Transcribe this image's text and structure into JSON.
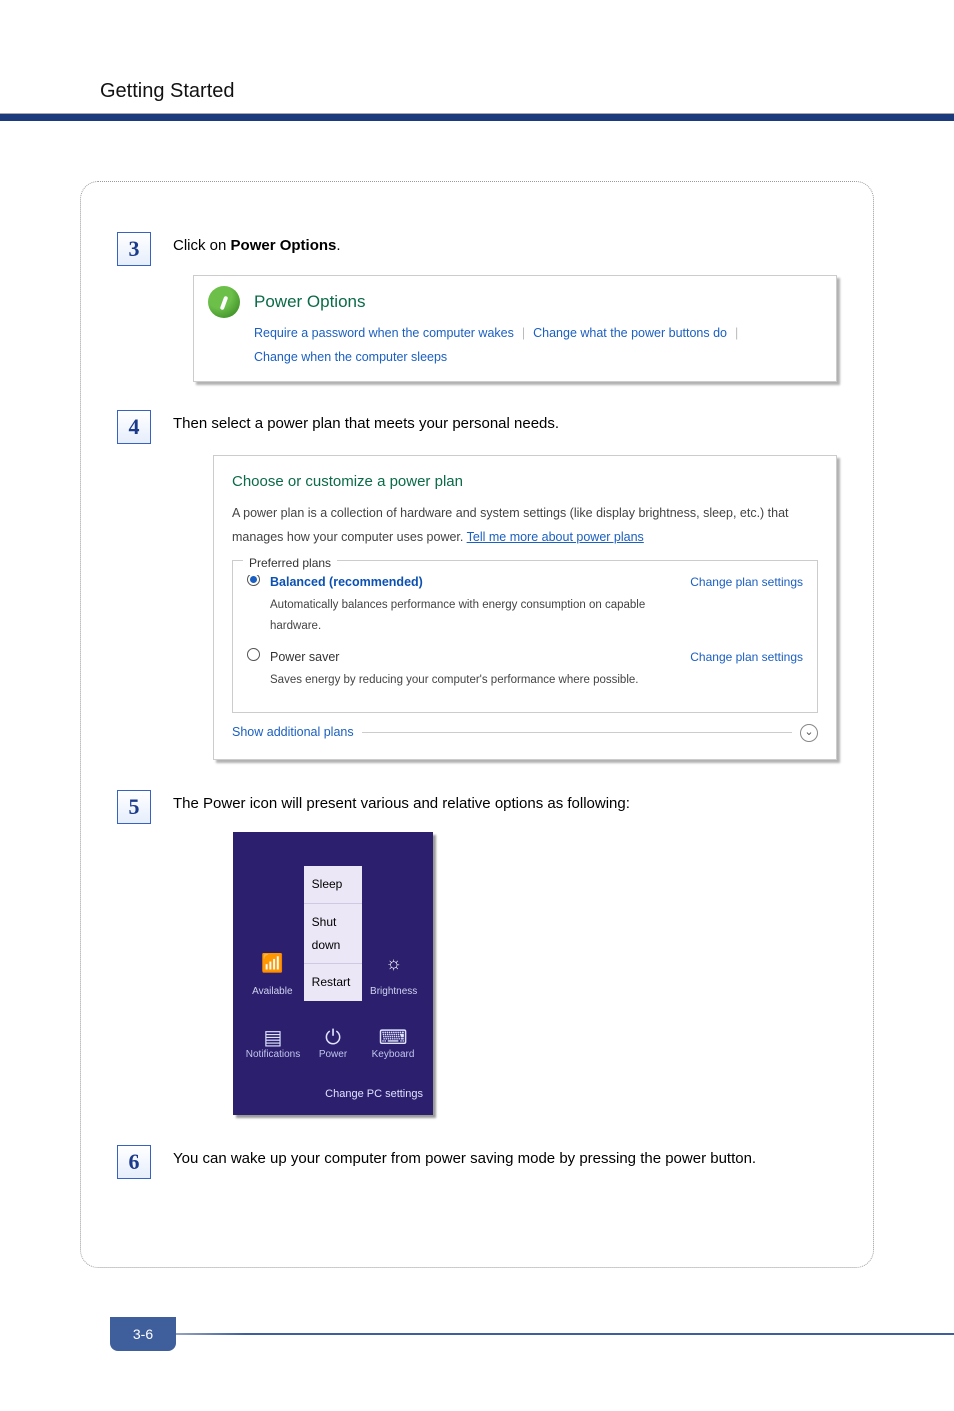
{
  "header": {
    "title": "Getting Started"
  },
  "page_number": "3-6",
  "steps": {
    "s3": {
      "num": "3",
      "text_pre": "Click on ",
      "text_bold": "Power Options",
      "text_post": ".",
      "panel": {
        "title": "Power Options",
        "link1": "Require a password when the computer wakes",
        "link2": "Change what the power buttons do",
        "link3": "Change when the computer sleeps"
      }
    },
    "s4": {
      "num": "4",
      "text": "Then select a power plan that meets your personal needs.",
      "panel": {
        "title": "Choose or customize a power plan",
        "desc": "A power plan is a collection of hardware and system settings (like display brightness, sleep, etc.) that manages how your computer uses power.",
        "more_link": "Tell me more about power plans",
        "legend": "Preferred plans",
        "plan1": {
          "name": "Balanced (recommended)",
          "sub": "Automatically balances performance with energy consumption on capable hardware.",
          "change": "Change plan settings"
        },
        "plan2": {
          "name": "Power saver",
          "sub": "Saves energy by reducing your computer's performance where possible.",
          "change": "Change plan settings"
        },
        "show": "Show additional plans"
      }
    },
    "s5": {
      "num": "5",
      "text": "The Power icon will present various and relative options as following:",
      "panel": {
        "menu": {
          "sleep": "Sleep",
          "shutdown": "Shut down",
          "restart": "Restart"
        },
        "net_label": "Available",
        "bright_label": "Brightness",
        "row2": {
          "notif": "Notifications",
          "power": "Power",
          "kb": "Keyboard"
        },
        "change": "Change PC settings"
      }
    },
    "s6": {
      "num": "6",
      "text": "You can wake up your computer from power saving mode by pressing the power button."
    }
  }
}
